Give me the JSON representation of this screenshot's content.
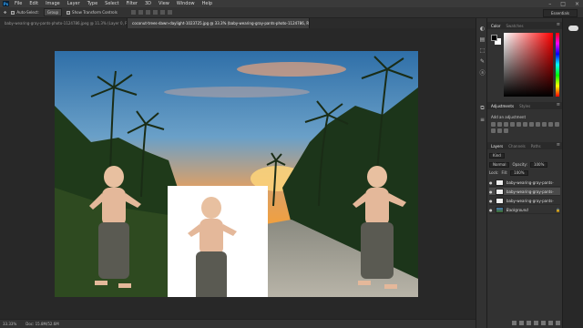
{
  "menubar": {
    "logo": "Ps",
    "items": [
      "File",
      "Edit",
      "Image",
      "Layer",
      "Type",
      "Select",
      "Filter",
      "3D",
      "View",
      "Window",
      "Help"
    ],
    "controls": [
      "–",
      "□",
      "×"
    ]
  },
  "options": {
    "auto_select_label": "Auto-Select:",
    "auto_select_value": "Group",
    "transform_label": "Show Transform Controls",
    "workspace": "Essentials"
  },
  "tabs": [
    {
      "label": "baby-wearing-gray-pants-photo-1124786.jpeg @ 11.3% (Layer 0, RGB/8)"
    },
    {
      "label": "coconut-trees-dawn-daylight-1023725.jpg @ 33.3% (baby-wearing-gray-pants-photo-1124786, RGB/8) *"
    }
  ],
  "statusbar": {
    "zoom": "33.33%",
    "doc": "Doc: 15.8M/52.6M"
  },
  "icon_strip": [
    "◐",
    "▤",
    "⬚",
    "✎",
    "ⓐ",
    "⧉",
    "≡"
  ],
  "color_panel": {
    "tabs": [
      "Color",
      "Swatches"
    ],
    "fg": "#000000",
    "bg": "#ffffff"
  },
  "adjustments_panel": {
    "tabs": [
      "Adjustments",
      "Styles"
    ],
    "add_label": "Add an adjustment"
  },
  "layers_panel": {
    "tabs": [
      "Layers",
      "Channels",
      "Paths"
    ],
    "kind_label": "Kind",
    "blend_mode": "Normal",
    "opacity_label": "Opacity:",
    "opacity_value": "100%",
    "lock_label": "Lock:",
    "fill_label": "Fill:",
    "fill_value": "100%",
    "layers": [
      {
        "name": "baby-wearing-gray-pants-p...",
        "selected": false,
        "background": false
      },
      {
        "name": "baby-wearing-gray-pants-p...",
        "selected": true,
        "background": false
      },
      {
        "name": "baby-wearing-gray-pants-p...",
        "selected": false,
        "background": false
      },
      {
        "name": "Background",
        "selected": false,
        "background": true
      }
    ]
  }
}
